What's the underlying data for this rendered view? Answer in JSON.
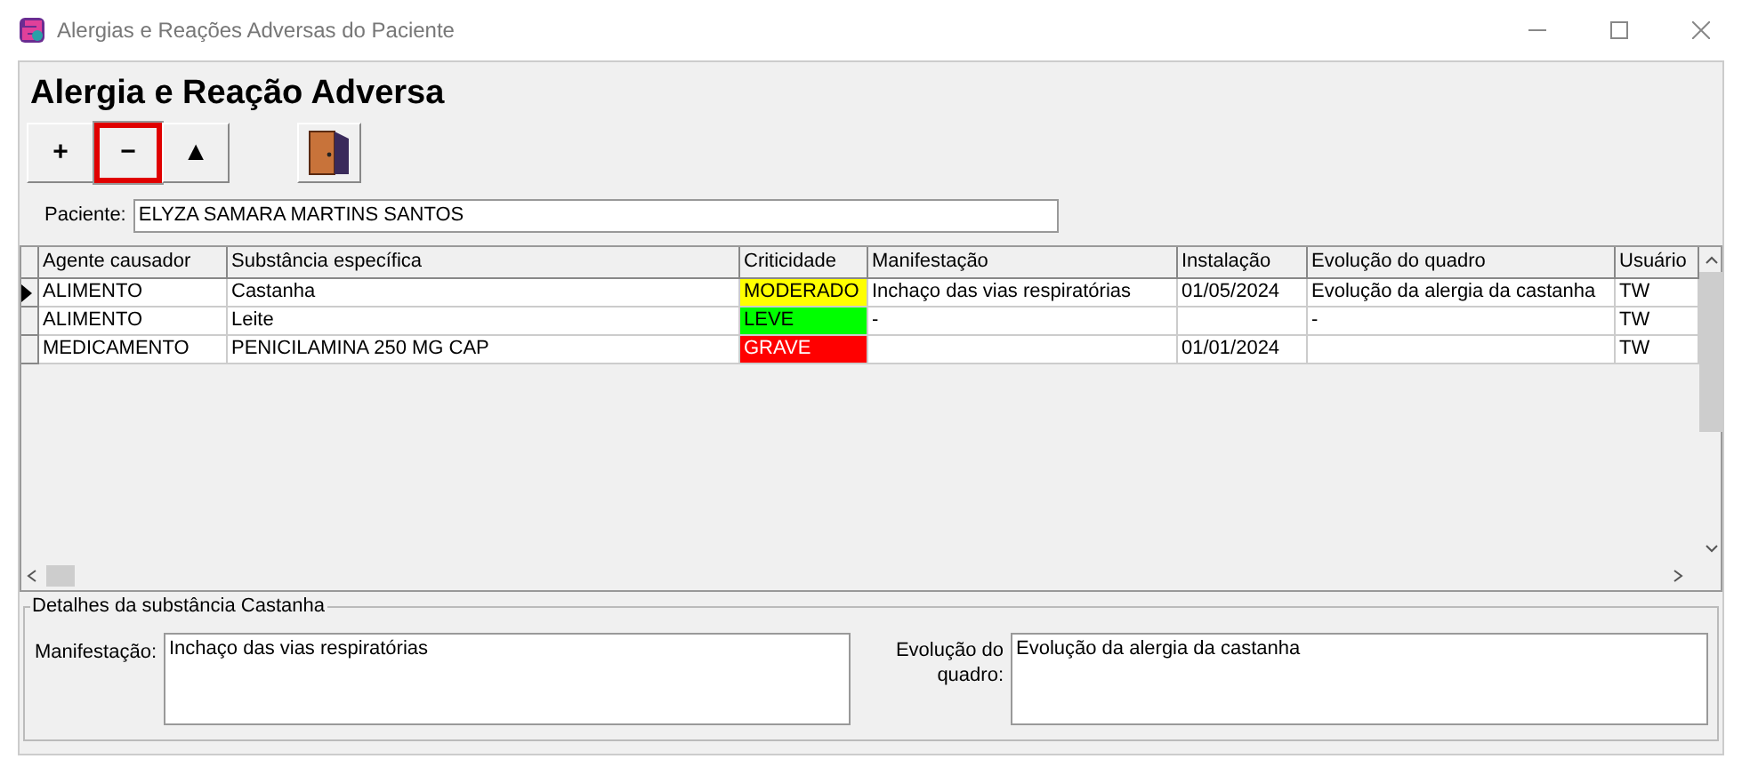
{
  "window": {
    "title": "Alergias e Reações Adversas do Paciente"
  },
  "heading": "Alergia e Reação Adversa",
  "toolbar": [
    {
      "label": "+",
      "highlighted": false
    },
    {
      "label": "−",
      "highlighted": true
    },
    {
      "label": "▲",
      "highlighted": false
    }
  ],
  "patient": {
    "label": "Paciente:",
    "value": "ELYZA SAMARA MARTINS SANTOS"
  },
  "table": {
    "columns": [
      "Agente causador",
      "Substância específica",
      "Criticidade",
      "Manifestação",
      "Instalação",
      "Evolução do quadro",
      "Usuário"
    ],
    "rows": [
      {
        "selected": true,
        "cells": [
          "ALIMENTO",
          "Castanha",
          "MODERADO",
          "Inchaço das vias respiratórias",
          "01/05/2024",
          "Evolução da alergia da castanha",
          "TW"
        ],
        "color": "#ffff00"
      },
      {
        "selected": false,
        "cells": [
          "ALIMENTO",
          "Leite",
          "LEVE",
          "-",
          "",
          "-",
          "TW"
        ],
        "color": "#00ff00"
      },
      {
        "selected": false,
        "cells": [
          "MEDICAMENTO",
          "PENICILAMINA 250 MG CAP",
          "GRAVE",
          "",
          "01/01/2024",
          "",
          "TW"
        ],
        "color": "#ff0000"
      }
    ]
  },
  "details": {
    "title": "Detalhes da substância Castanha",
    "manifestation_label": "Manifestação:",
    "manifestation": "Inchaço das vias respiratórias",
    "evolution_label": "Evolução do quadro:",
    "evolution": "Evolução da alergia da castanha"
  }
}
